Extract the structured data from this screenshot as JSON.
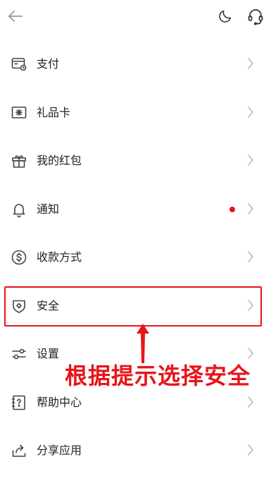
{
  "header": {
    "back_icon": "arrow-left-icon",
    "theme_icon": "moon-icon",
    "support_icon": "headset-icon"
  },
  "menu": {
    "items": [
      {
        "label": "支付",
        "icon": "payment-icon"
      },
      {
        "label": "礼品卡",
        "icon": "gift-card-icon"
      },
      {
        "label": "我的红包",
        "icon": "gift-box-icon"
      },
      {
        "label": "通知",
        "icon": "bell-icon",
        "has_badge": true
      },
      {
        "label": "收款方式",
        "icon": "dollar-icon"
      },
      {
        "label": "安全",
        "icon": "shield-icon"
      },
      {
        "label": "设置",
        "icon": "sliders-icon"
      },
      {
        "label": "帮助中心",
        "icon": "help-icon"
      },
      {
        "label": "分享应用",
        "icon": "share-icon"
      }
    ]
  },
  "annotation": {
    "text": "根据提示选择安全",
    "highlighted_item": "安全"
  },
  "colors": {
    "accent_red": "#e8141b",
    "badge_red": "#e8141b",
    "icon_gray": "#444444",
    "chevron_gray": "#b8b8b8"
  }
}
